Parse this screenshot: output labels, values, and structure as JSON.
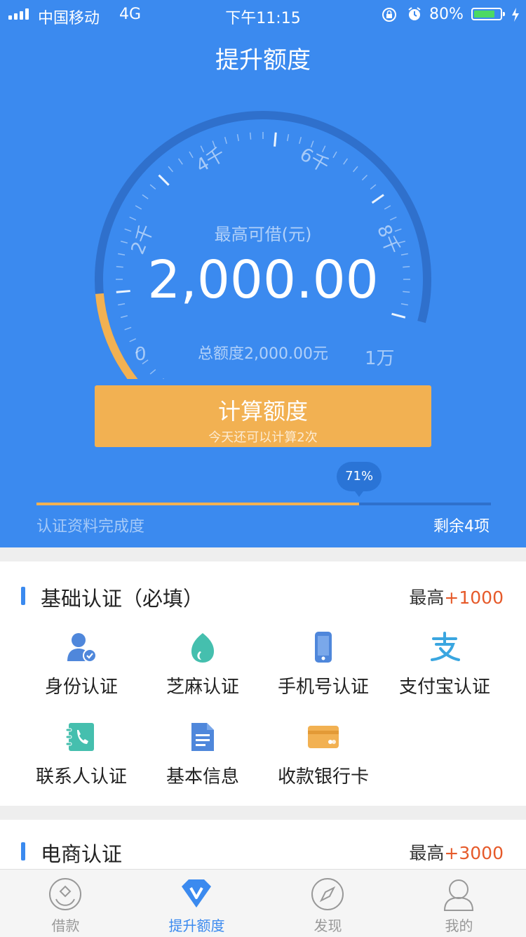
{
  "status": {
    "carrier": "中国移动",
    "network": "4G",
    "time": "下午11:15",
    "battery": "80%",
    "battery_level": 0.8
  },
  "header": {
    "title": "提升额度"
  },
  "gauge": {
    "caption": "最高可借(元)",
    "amount": "2,000.00",
    "total": "总额度2,000.00元",
    "labels": [
      "0",
      "2千",
      "4千",
      "6千",
      "8千",
      "1万"
    ],
    "fill_fraction": 0.2,
    "colors": {
      "fill": "#f2b152",
      "track": "#2f70cc"
    }
  },
  "calc_button": {
    "title": "计算额度",
    "subtitle": "今天还可以计算2次"
  },
  "progress": {
    "percent_label": "71%",
    "value": 0.71,
    "label": "认证资料完成度",
    "remaining": "剩余4项"
  },
  "basic_auth": {
    "title": "基础认证（必填）",
    "max_prefix": "最高",
    "max_value": "+1000",
    "items": [
      {
        "label": "身份认证",
        "icon": "id-user-icon"
      },
      {
        "label": "芝麻认证",
        "icon": "sesame-icon"
      },
      {
        "label": "手机号认证",
        "icon": "phone-icon"
      },
      {
        "label": "支付宝认证",
        "icon": "alipay-icon"
      },
      {
        "label": "联系人认证",
        "icon": "contact-icon"
      },
      {
        "label": "基本信息",
        "icon": "document-icon"
      },
      {
        "label": "收款银行卡",
        "icon": "bank-card-icon"
      }
    ]
  },
  "ecommerce_auth": {
    "title": "电商认证",
    "max_prefix": "最高",
    "max_value": "+3000"
  },
  "tabs": [
    {
      "label": "借款",
      "icon": "loan-icon"
    },
    {
      "label": "提升额度",
      "icon": "boost-icon",
      "active": true
    },
    {
      "label": "发现",
      "icon": "compass-icon"
    },
    {
      "label": "我的",
      "icon": "profile-icon"
    }
  ],
  "colors": {
    "primary": "#3b8aef",
    "accent": "#f2b152",
    "highlight": "#e65a2a"
  }
}
